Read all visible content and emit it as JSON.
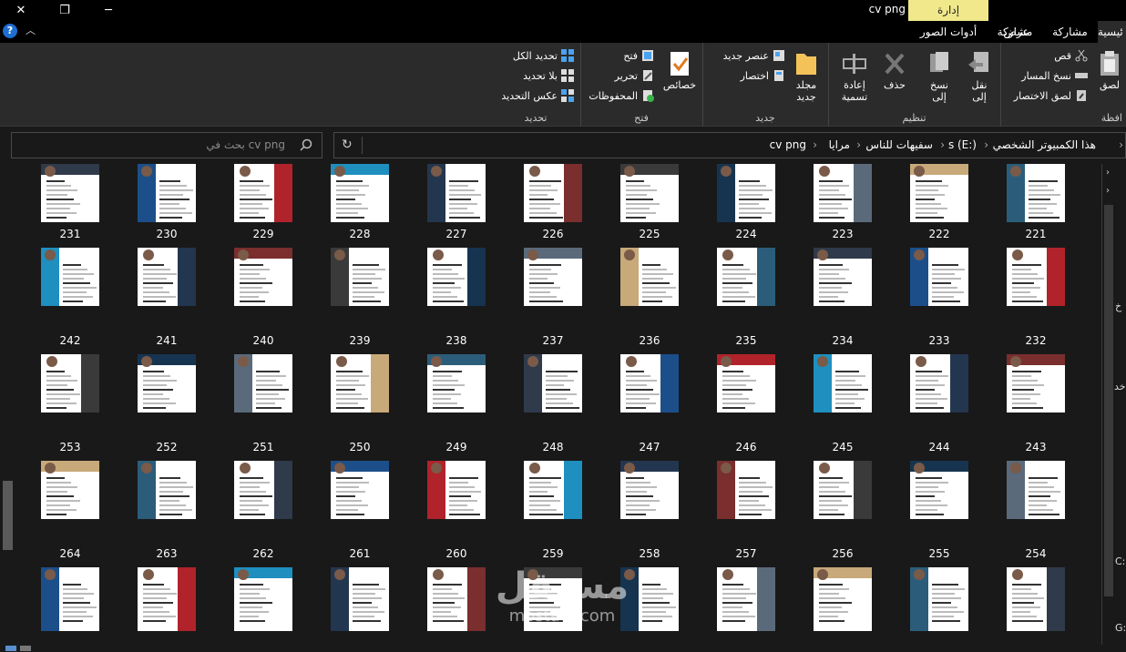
{
  "window": {
    "title": "cv png",
    "close_glyph": "✕",
    "restore_glyph": "❐",
    "minimize_glyph": "─",
    "context_tab": "إدارة",
    "help_glyph": "?",
    "collapse_glyph": "︿"
  },
  "tabs": [
    {
      "label": "ئيسية"
    },
    {
      "label": "مشاركة"
    },
    {
      "label": "عرض"
    },
    {
      "label": "أدوات الصور"
    }
  ],
  "ribbon": {
    "clipboard": {
      "label": "افظة",
      "paste": "لصق",
      "cut": "قص",
      "copy_path": "نسخ المسار",
      "paste_shortcut": "لصق الاختصار"
    },
    "organize": {
      "label": "تنظيم",
      "move_to": "نقل\nإلى",
      "copy_to": "نسخ\nإلى",
      "delete": "حذف",
      "rename": "إعادة\nتسمية"
    },
    "new": {
      "label": "جديد",
      "new_folder": "مجلد\nجديد",
      "new_item": "عنصر جديد",
      "easy_access": "اختصار"
    },
    "open": {
      "label": "فتح",
      "properties": "خصائص",
      "open": "فتح",
      "edit": "تحرير",
      "history": "المحفوظات"
    },
    "select": {
      "label": "تحديد",
      "select_all": "تحديد الكل",
      "select_none": "بلا تحديد",
      "invert": "عكس التحديد"
    }
  },
  "address": {
    "crumbs": [
      "هذا الكمبيوتر الشخصي",
      "s (E:)",
      "سفيهات للناس",
      "مرايا",
      "cv png"
    ],
    "refresh_glyph": "↻"
  },
  "search": {
    "placeholder": "بحث في cv png"
  },
  "files": {
    "row1": [
      "231",
      "230",
      "229",
      "228",
      "227",
      "226",
      "225",
      "224",
      "223",
      "222",
      "221"
    ],
    "row2": [
      "242",
      "241",
      "240",
      "239",
      "238",
      "237",
      "236",
      "235",
      "234",
      "233",
      "232"
    ],
    "row3": [
      "253",
      "252",
      "251",
      "250",
      "249",
      "248",
      "247",
      "246",
      "245",
      "244",
      "243"
    ],
    "row4": [
      "264",
      "263",
      "262",
      "261",
      "260",
      "259",
      "258",
      "257",
      "256",
      "255",
      "254"
    ],
    "row5": [
      "",
      "",
      "",
      "",
      "",
      "",
      "",
      "",
      "",
      "",
      ""
    ]
  },
  "watermark": {
    "arabic": "مستقل",
    "latin": "mostaql.com"
  },
  "nav_edge": {
    "a": "خ",
    "b": "خد",
    "c": "C:",
    "d": "G:"
  }
}
